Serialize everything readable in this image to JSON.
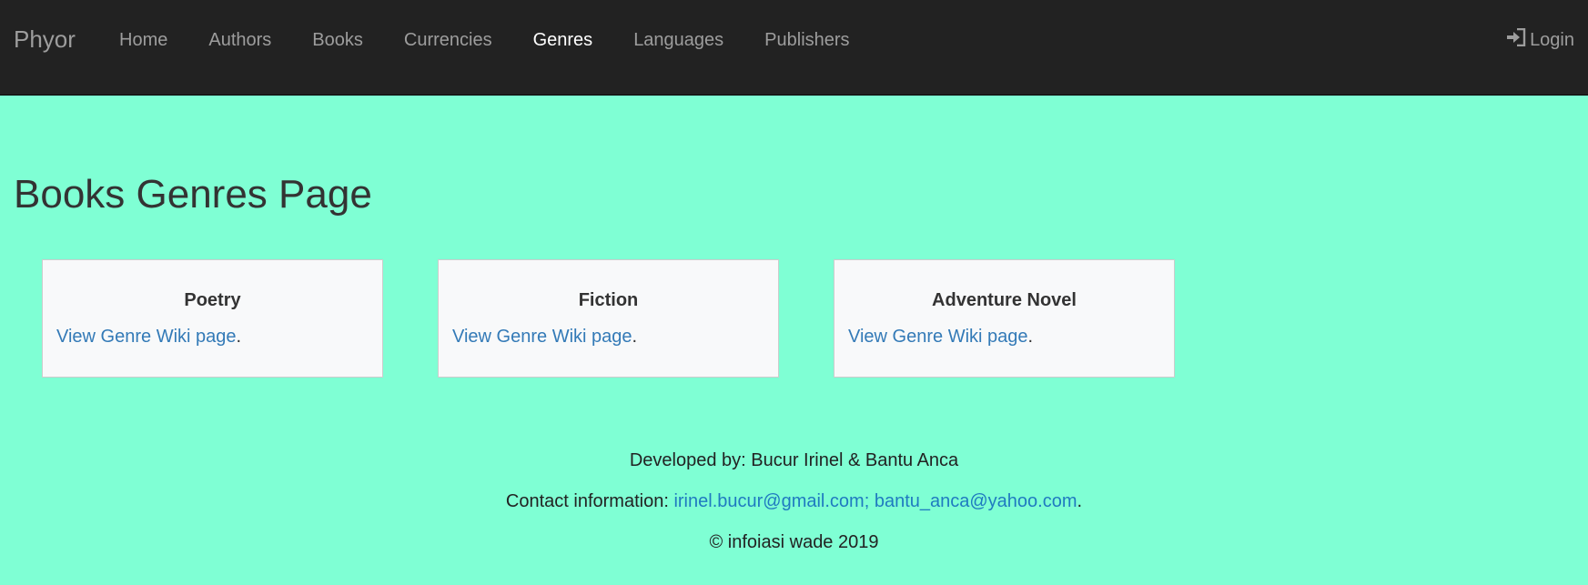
{
  "navbar": {
    "brand": "Phyor",
    "items": [
      {
        "label": "Home",
        "active": false
      },
      {
        "label": "Authors",
        "active": false
      },
      {
        "label": "Books",
        "active": false
      },
      {
        "label": "Currencies",
        "active": false
      },
      {
        "label": "Genres",
        "active": true
      },
      {
        "label": "Languages",
        "active": false
      },
      {
        "label": "Publishers",
        "active": false
      }
    ],
    "login_label": "Login",
    "login_icon": "log-in-icon"
  },
  "main": {
    "title": "Books Genres Page",
    "genres": [
      {
        "name": "Poetry",
        "link_text": "View Genre Wiki page",
        "suffix": "."
      },
      {
        "name": "Fiction",
        "link_text": "View Genre Wiki page",
        "suffix": "."
      },
      {
        "name": "Adventure Novel",
        "link_text": "View Genre Wiki page",
        "suffix": "."
      }
    ]
  },
  "footer": {
    "developed_by": "Developed by: Bucur Irinel & Bantu Anca",
    "contact_label": "Contact information: ",
    "contact_emails": "irinel.bucur@gmail.com; bantu_anca@yahoo.com",
    "contact_suffix": ".",
    "copyright": "© infoiasi wade 2019"
  },
  "colors": {
    "background": "#7fffd4",
    "navbar": "#222222",
    "nav_text": "#9d9d9d",
    "nav_active": "#ffffff",
    "link": "#337ab7",
    "card_bg": "#f8f9fa"
  }
}
